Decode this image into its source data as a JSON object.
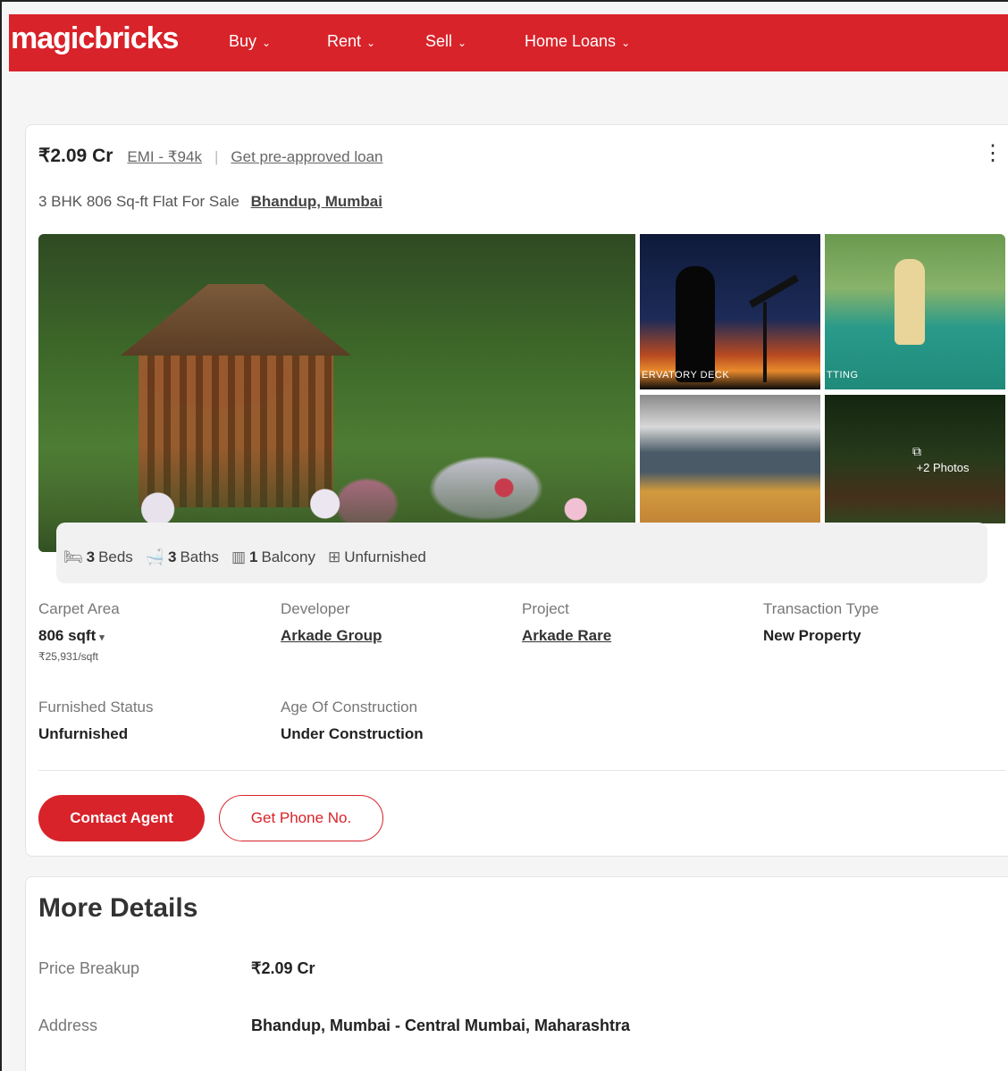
{
  "header": {
    "logo": "magicbricks",
    "nav": [
      {
        "label": "Buy"
      },
      {
        "label": "Rent"
      },
      {
        "label": "Sell"
      },
      {
        "label": "Home Loans"
      }
    ]
  },
  "listing": {
    "price": "₹2.09 Cr",
    "emi": "EMI - ₹94k",
    "separator": "|",
    "preapproved": "Get pre-approved loan",
    "subtitle": "3 BHK 806 Sq-ft Flat For Sale",
    "location": "Bhandup, Mumbai",
    "gallery": {
      "thumb1_caption": "ERVATORY DECK",
      "thumb2_caption": "TTING",
      "more_photos": "+2 Photos"
    },
    "amenities": [
      {
        "count": "3",
        "label": "Beds",
        "icon": "bed-icon"
      },
      {
        "count": "3",
        "label": "Baths",
        "icon": "bath-icon"
      },
      {
        "count": "1",
        "label": "Balcony",
        "icon": "balcony-icon"
      },
      {
        "count": "",
        "label": "Unfurnished",
        "icon": "furnishing-icon"
      }
    ],
    "specs": {
      "carpet_area": {
        "label": "Carpet Area",
        "value": "806 sqft",
        "sub": "₹25,931/sqft"
      },
      "developer": {
        "label": "Developer",
        "value": "Arkade Group"
      },
      "project": {
        "label": "Project",
        "value": "Arkade Rare"
      },
      "transaction": {
        "label": "Transaction Type",
        "value": "New Property"
      },
      "furnished": {
        "label": "Furnished Status",
        "value": "Unfurnished"
      },
      "age": {
        "label": "Age Of Construction",
        "value": "Under Construction"
      }
    },
    "buttons": {
      "contact": "Contact Agent",
      "phone": "Get Phone No."
    }
  },
  "more_details": {
    "title": "More Details",
    "rows": [
      {
        "key": "Price Breakup",
        "value": "₹2.09 Cr"
      },
      {
        "key": "Address",
        "value": "Bhandup, Mumbai - Central Mumbai, Maharashtra"
      }
    ]
  },
  "colors": {
    "brand": "#d8232a"
  }
}
